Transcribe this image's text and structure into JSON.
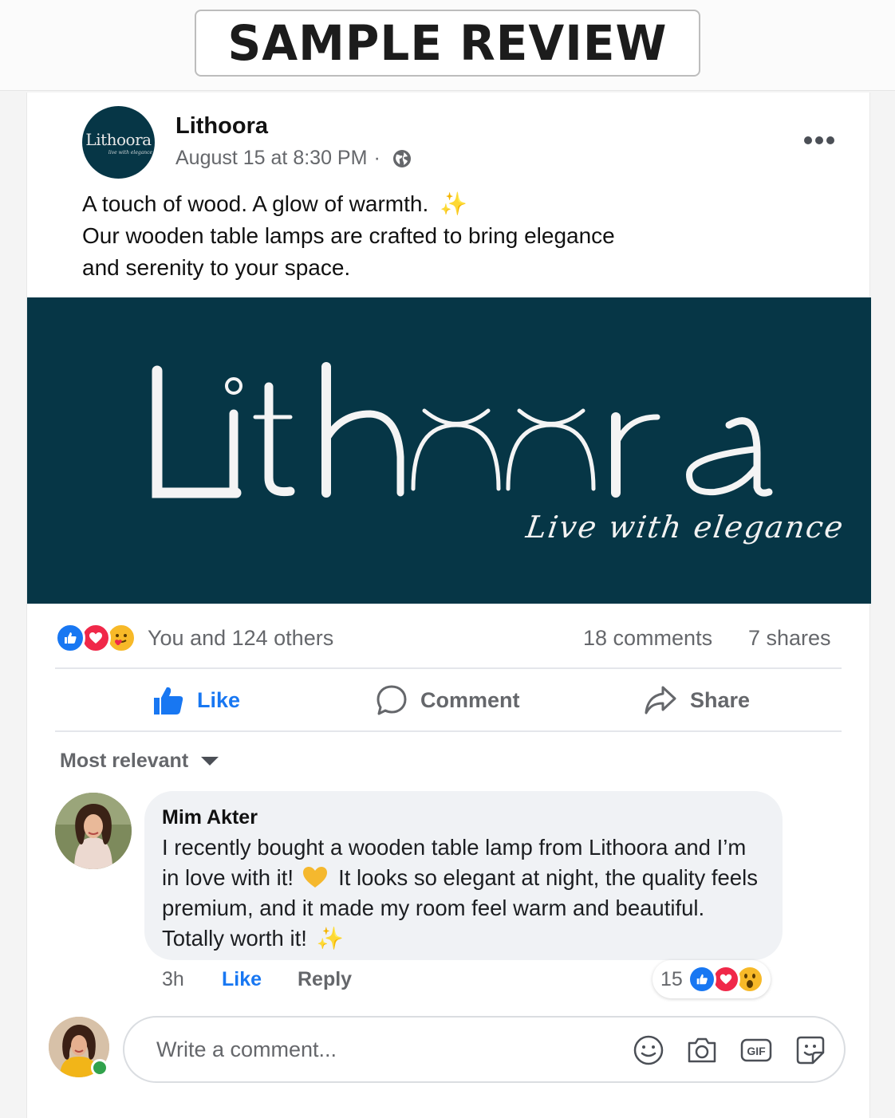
{
  "badge": {
    "label": "SAMPLE REVIEW"
  },
  "post": {
    "avatar_logo_text": "Lithoora",
    "avatar_logo_sub": "live with elegance",
    "page_name": "Lithoora",
    "timestamp": "August 15 at 8:30 PM",
    "separator": "·",
    "privacy_icon": "globe-icon",
    "caption_line1": "A touch of wood. A glow of warmth.",
    "caption_line2": "Our wooden table lamps are crafted to bring elegance",
    "caption_line3": "and serenity to your space.",
    "caption_emoji": "✨"
  },
  "banner": {
    "brand": "Lithoora",
    "tagline": "Live with elegance",
    "background": "#063646"
  },
  "stats": {
    "reaction_icons": [
      "like-icon",
      "love-icon",
      "care-icon"
    ],
    "reactions_text": "You and 124 others",
    "comments": "18 comments",
    "shares": "7 shares"
  },
  "actions": {
    "like": "Like",
    "comment": "Comment",
    "share": "Share",
    "like_active": true,
    "accent": "#1877f2"
  },
  "comments_section": {
    "sort_label": "Most relevant",
    "comment": {
      "author": "Mim Akter",
      "text_part1": "I recently bought a wooden table lamp from Lithoora and I’m in love with it!",
      "text_part2": "It looks so elegant at night, the quality feels premium, and it made my room feel warm and beautiful. Totally worth it!",
      "emoji_1": "yellow-heart-icon",
      "emoji_2": "✨",
      "time": "3h",
      "like_label": "Like",
      "reply_label": "Reply",
      "reaction_count": "15",
      "reaction_icons": [
        "like-icon",
        "love-icon",
        "wow-icon"
      ]
    }
  },
  "composer": {
    "placeholder": "Write a comment...",
    "value": "",
    "tools": [
      "emoji-icon",
      "camera-icon",
      "gif-icon",
      "sticker-icon"
    ]
  }
}
